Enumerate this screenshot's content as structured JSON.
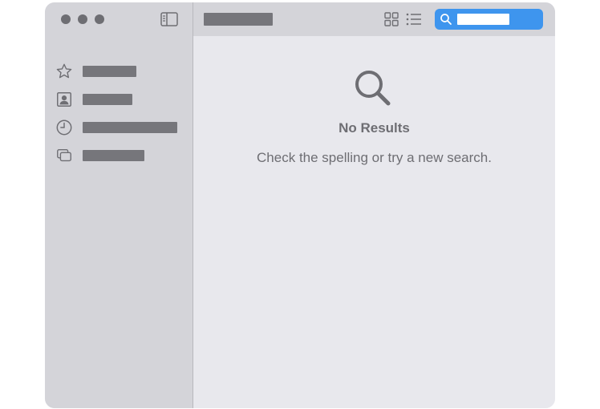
{
  "window": {
    "title": "",
    "traffic_lights": [
      "close",
      "minimize",
      "zoom"
    ]
  },
  "toolbar": {
    "sidebar_toggle_icon": "sidebar-left-icon",
    "grid_view_icon": "grid-view-icon",
    "list_view_icon": "list-view-icon"
  },
  "search": {
    "icon": "search-icon",
    "value": ""
  },
  "sidebar": {
    "items": [
      {
        "icon": "star-icon",
        "label": ""
      },
      {
        "icon": "contact-card-icon",
        "label": ""
      },
      {
        "icon": "clock-icon",
        "label": ""
      },
      {
        "icon": "stacked-windows-icon",
        "label": ""
      }
    ]
  },
  "empty_state": {
    "icon": "magnifying-glass-icon",
    "title": "No Results",
    "subtitle": "Check the spelling or try a new search."
  },
  "colors": {
    "sidebar_bg": "#d4d4d9",
    "content_bg": "#e8e8ed",
    "accent": "#3e95ee",
    "icon_gray": "#6e6e73",
    "redaction": "#76767b"
  }
}
